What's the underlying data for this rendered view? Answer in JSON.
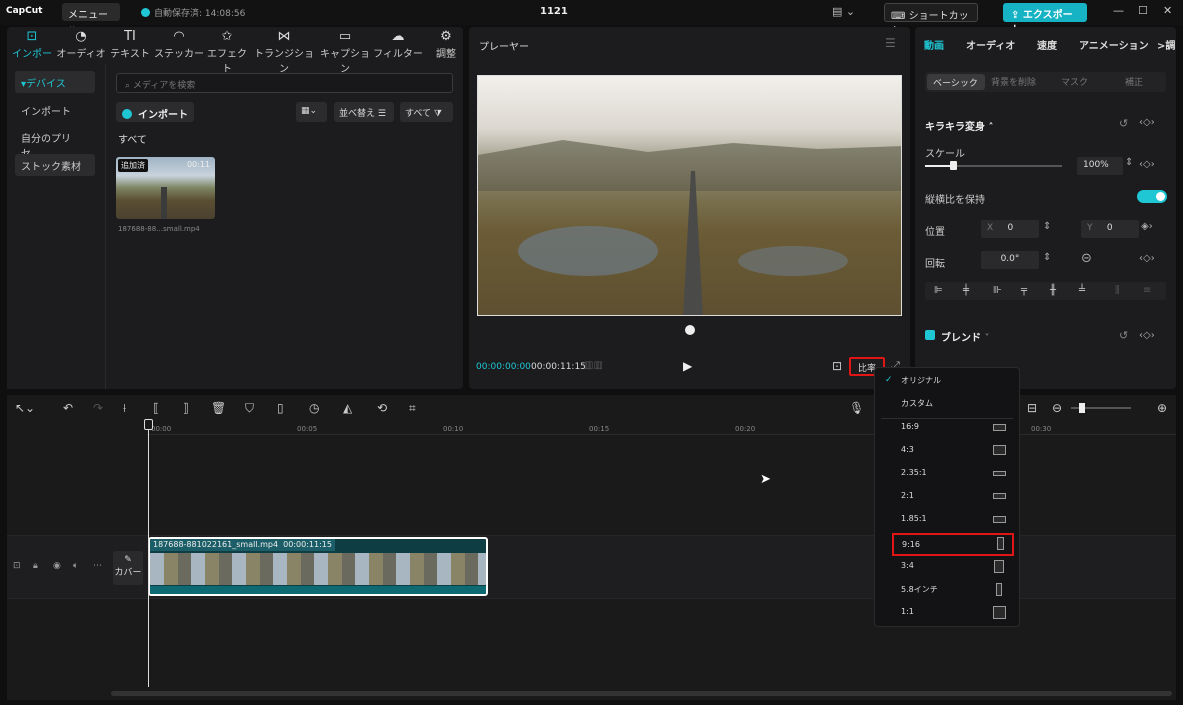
{
  "app": {
    "logo": "CapCut",
    "menu_label": "メニュー",
    "saved_status": "自動保存済: 14:08:56",
    "project_title": "1121",
    "shortcut_label": "ショートカット",
    "export_label": "エクスポート"
  },
  "media": {
    "tabs": [
      {
        "label": "インポート",
        "icon": "import-icon"
      },
      {
        "label": "オーディオ",
        "icon": "audio-icon"
      },
      {
        "label": "テキスト",
        "icon": "text-icon"
      },
      {
        "label": "ステッカー",
        "icon": "sticker-icon"
      },
      {
        "label": "エフェクト",
        "icon": "effect-icon"
      },
      {
        "label": "トランジション",
        "icon": "transition-icon"
      },
      {
        "label": "キャプション",
        "icon": "caption-icon"
      },
      {
        "label": "フィルター",
        "icon": "filter-icon"
      },
      {
        "label": "調整",
        "icon": "adjust-icon"
      }
    ],
    "sidebar": [
      "▾デバイス",
      "インポート",
      "自分のプリセ…",
      "ストック素材"
    ],
    "search_placeholder": "メディアを検索",
    "import_label": "インポート",
    "sort_label": "並べ替え",
    "filter_label": "すべて",
    "all_label": "すべて",
    "thumb_badge": "追加済",
    "thumb_duration": "00:11",
    "thumb_name": "187688-88…small.mp4"
  },
  "player": {
    "title": "プレーヤー",
    "timecode_current": "00:00:00:00",
    "timecode_total": "00:00:11:15",
    "ratio_label": "比率"
  },
  "props": {
    "tabs": [
      "動画",
      "オーディオ",
      "速度",
      "アニメーション",
      ">調"
    ],
    "subtabs": [
      "ベーシック",
      "背景を削除",
      "マスク",
      "補正"
    ],
    "section_transform": "キラキラ変身",
    "scale_label": "スケール",
    "scale_value": "100%",
    "keep_ratio_label": "縦横比を保持",
    "position_label": "位置",
    "pos_x_label": "X",
    "pos_x_value": "0",
    "pos_y_label": "Y",
    "pos_y_value": "0",
    "rotation_label": "回転",
    "rotation_value": "0.0°",
    "blend_label": "ブレンド"
  },
  "timeline": {
    "ticks": [
      "00:00",
      "00:05",
      "00:10",
      "00:15",
      "00:20",
      "00:30"
    ],
    "cover_label": "カバー",
    "clip_name": "187688-881022161_small.mp4",
    "clip_duration": "00:00:11:15"
  },
  "ratio_menu": {
    "items": [
      {
        "label": "オリジナル",
        "checked": true
      },
      {
        "label": "カスタム"
      },
      {
        "label": "16:9"
      },
      {
        "label": "4:3"
      },
      {
        "label": "2.35:1"
      },
      {
        "label": "2:1"
      },
      {
        "label": "1.85:1"
      },
      {
        "label": "9:16",
        "highlighted": true
      },
      {
        "label": "3:4"
      },
      {
        "label": "5.8インチ"
      },
      {
        "label": "1:1"
      }
    ]
  },
  "colors": {
    "accent": "#1fc7d4",
    "highlight": "#e01515"
  }
}
